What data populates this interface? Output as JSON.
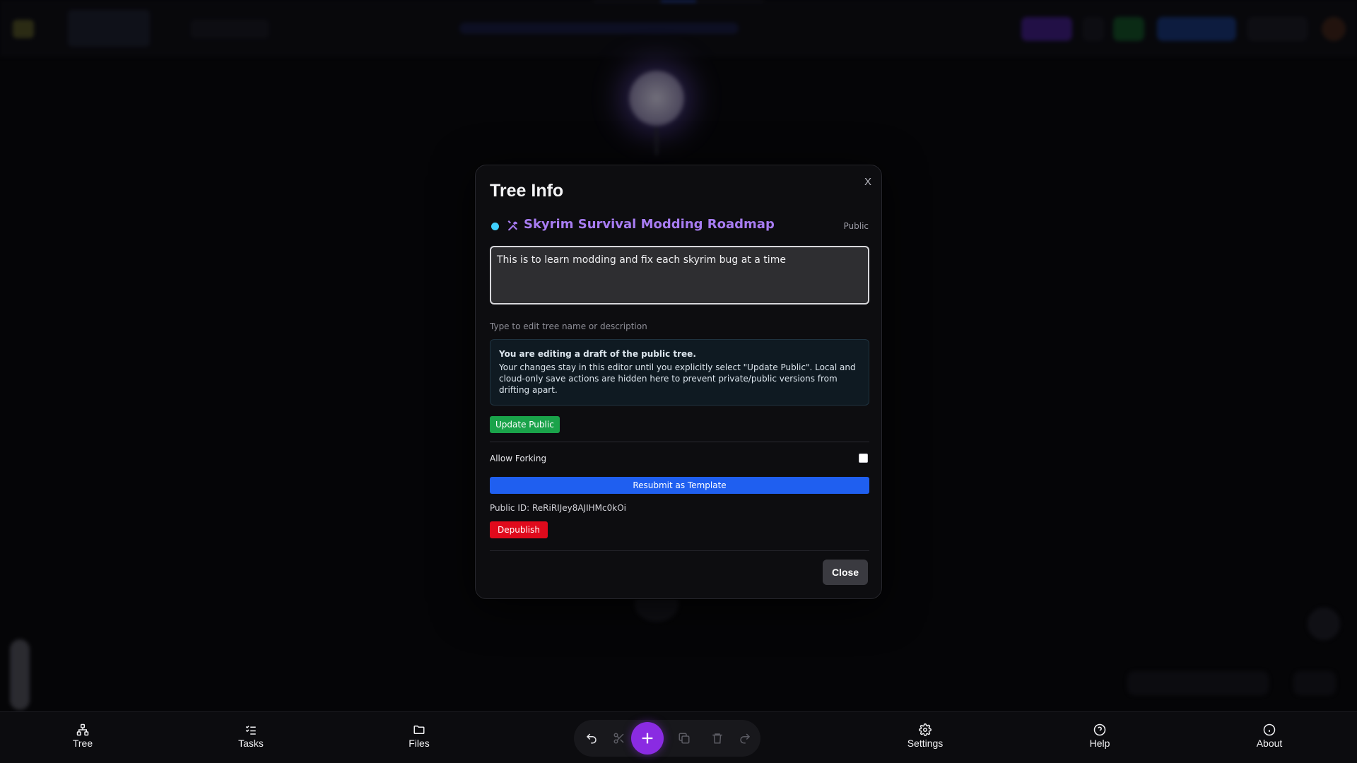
{
  "modal": {
    "title": "Tree Info",
    "close_x": "X",
    "tree_name": "Skyrim Survival Modding Roadmap",
    "visibility": "Public",
    "description": "This is to learn modding and fix each skyrim bug at a time",
    "hint": "Type to edit tree name or description",
    "notice_title": "You are editing a draft of the public tree.",
    "notice_body": "Your changes stay in this editor until you explicitly select \"Update Public\". Local and cloud-only save actions are hidden here to prevent private/public versions from drifting apart.",
    "update_public_label": "Update Public",
    "allow_forking_label": "Allow Forking",
    "allow_forking_checked": false,
    "resubmit_label": "Resubmit as Template",
    "public_id_text": "Public ID: ReRiRIJey8AJIHMc0kOi",
    "depublish_label": "Depublish",
    "close_label": "Close"
  },
  "bottom_nav": {
    "tree": "Tree",
    "tasks": "Tasks",
    "files": "Files",
    "settings": "Settings",
    "help": "Help",
    "about": "About"
  },
  "colors": {
    "accent_purple": "#a77cf2",
    "add_button": "#8a2be2",
    "update_green": "#1aa34a",
    "resubmit_blue": "#1f5ff0",
    "depublish_red": "#e00a1c",
    "status_dot": "#3fd0ff"
  },
  "icons": {
    "tree": "tree-icon",
    "tasks": "checklist-icon",
    "files": "folder-icon",
    "settings": "gear-icon",
    "help": "help-circle-icon",
    "about": "info-icon",
    "undo": "undo-icon",
    "cut": "scissors-icon",
    "add": "plus-icon",
    "copy": "copy-icon",
    "delete": "trash-icon",
    "redo": "redo-icon",
    "tree_title": "tools-icon"
  }
}
